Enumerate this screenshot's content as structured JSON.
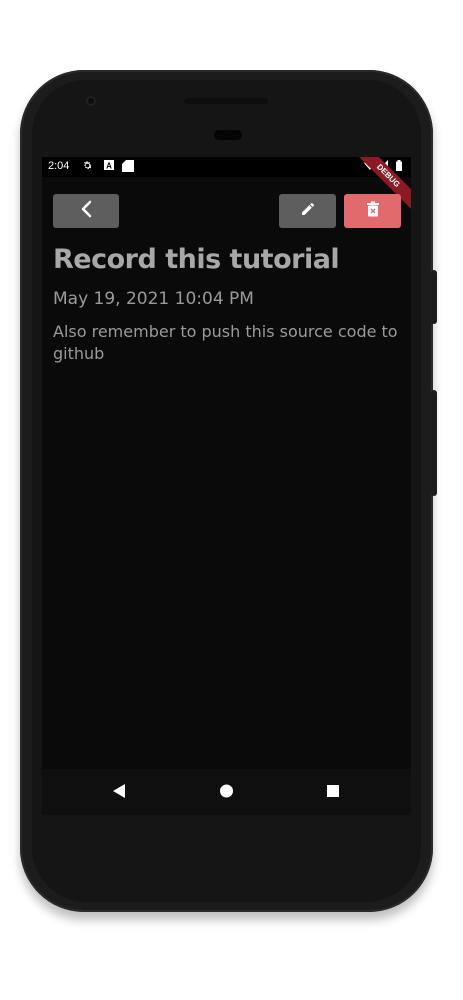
{
  "status_bar": {
    "time": "2:04",
    "icons": [
      "gear-icon",
      "notification-a-icon",
      "sd-card-icon",
      "wifi-icon",
      "signal-icon",
      "battery-icon"
    ]
  },
  "debug_banner": {
    "label": "DEBUG"
  },
  "toolbar": {
    "back_icon": "chevron-left-icon",
    "edit_icon": "pencil-icon",
    "delete_icon": "trash-icon"
  },
  "note": {
    "title": "Record this tutorial",
    "date": "May 19, 2021 10:04 PM",
    "body": "Also remember to push this source code to github"
  },
  "nav_bar": {
    "icons": [
      "back-triangle-icon",
      "home-circle-icon",
      "recents-square-icon"
    ]
  },
  "colors": {
    "background": "#0a0a0a",
    "button_gray": "#5e5e5e",
    "delete_red": "#e36a6c",
    "text": "#9a9a9a",
    "debug_banner": "#8b1a24"
  }
}
